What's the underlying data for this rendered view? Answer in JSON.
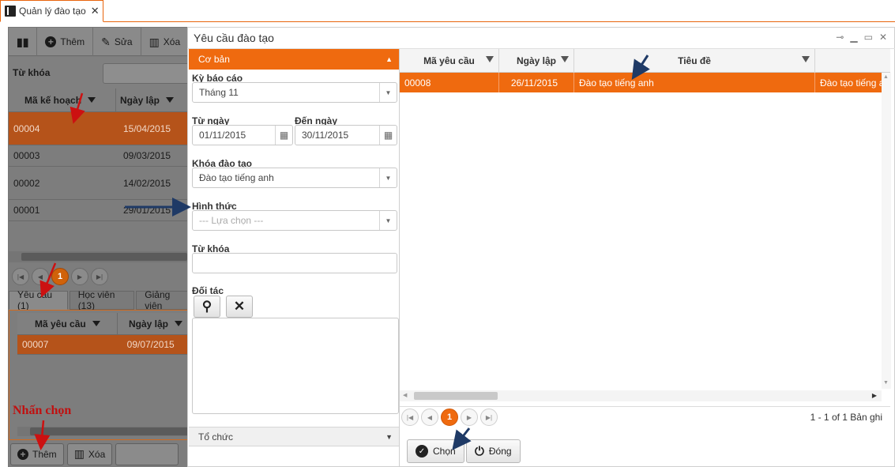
{
  "app_tab": {
    "label": "Quản lý đào tạo"
  },
  "background": {
    "toolbar": {
      "add": "Thêm",
      "edit": "Sửa",
      "delete": "Xóa"
    },
    "keyword_label": "Từ khóa",
    "grid": {
      "headers": [
        "Mã kế hoạch",
        "Ngày lập"
      ],
      "rows": [
        {
          "code": "00004",
          "date": "15/04/2015"
        },
        {
          "code": "00003",
          "date": "09/03/2015"
        },
        {
          "code": "00002",
          "date": "14/02/2015"
        },
        {
          "code": "00001",
          "date": "29/01/2015"
        }
      ]
    },
    "pager": {
      "current": "1"
    },
    "tabs": [
      "Yêu cầu (1)",
      "Học viên (13)",
      "Giảng viên"
    ],
    "sub_grid": {
      "headers": [
        "Mã yêu cầu",
        "Ngày lập"
      ],
      "rows": [
        {
          "code": "00007",
          "date": "09/07/2015"
        }
      ]
    },
    "bottom_buttons": {
      "add": "Thêm",
      "delete": "Xóa"
    },
    "annotation": "Nhấn chọn"
  },
  "dialog": {
    "title": "Yêu cầu đào tạo",
    "section_basic": "Cơ bản",
    "section_org": "Tổ chức",
    "fields": {
      "period_label": "Kỳ báo cáo",
      "period_value": "Tháng 11",
      "from_label": "Từ ngày",
      "from_value": "01/11/2015",
      "to_label": "Đến ngày",
      "to_value": "30/11/2015",
      "course_label": "Khóa đào tạo",
      "course_value": "Đào tạo tiếng anh",
      "form_label": "Hình thức",
      "form_placeholder": "--- Lựa chọn ---",
      "keyword_label": "Từ khóa",
      "partner_label": "Đối tác"
    },
    "grid": {
      "headers": {
        "code": "Mã yêu cầu",
        "date": "Ngày lập",
        "title": "Tiêu đề"
      },
      "rows": [
        {
          "code": "00008",
          "date": "26/11/2015",
          "title": "Đào tạo tiếng anh",
          "extra": "Đào tạo tiếng anh"
        }
      ]
    },
    "pager": {
      "current": "1",
      "summary": "1 - 1 of 1 Bản ghi"
    },
    "buttons": {
      "choose": "Chọn",
      "close": "Đóng"
    }
  },
  "colors": {
    "accent": "#ef6a0f",
    "arrow": "#1f3a66",
    "annotation_arrow": "#cc1111"
  }
}
